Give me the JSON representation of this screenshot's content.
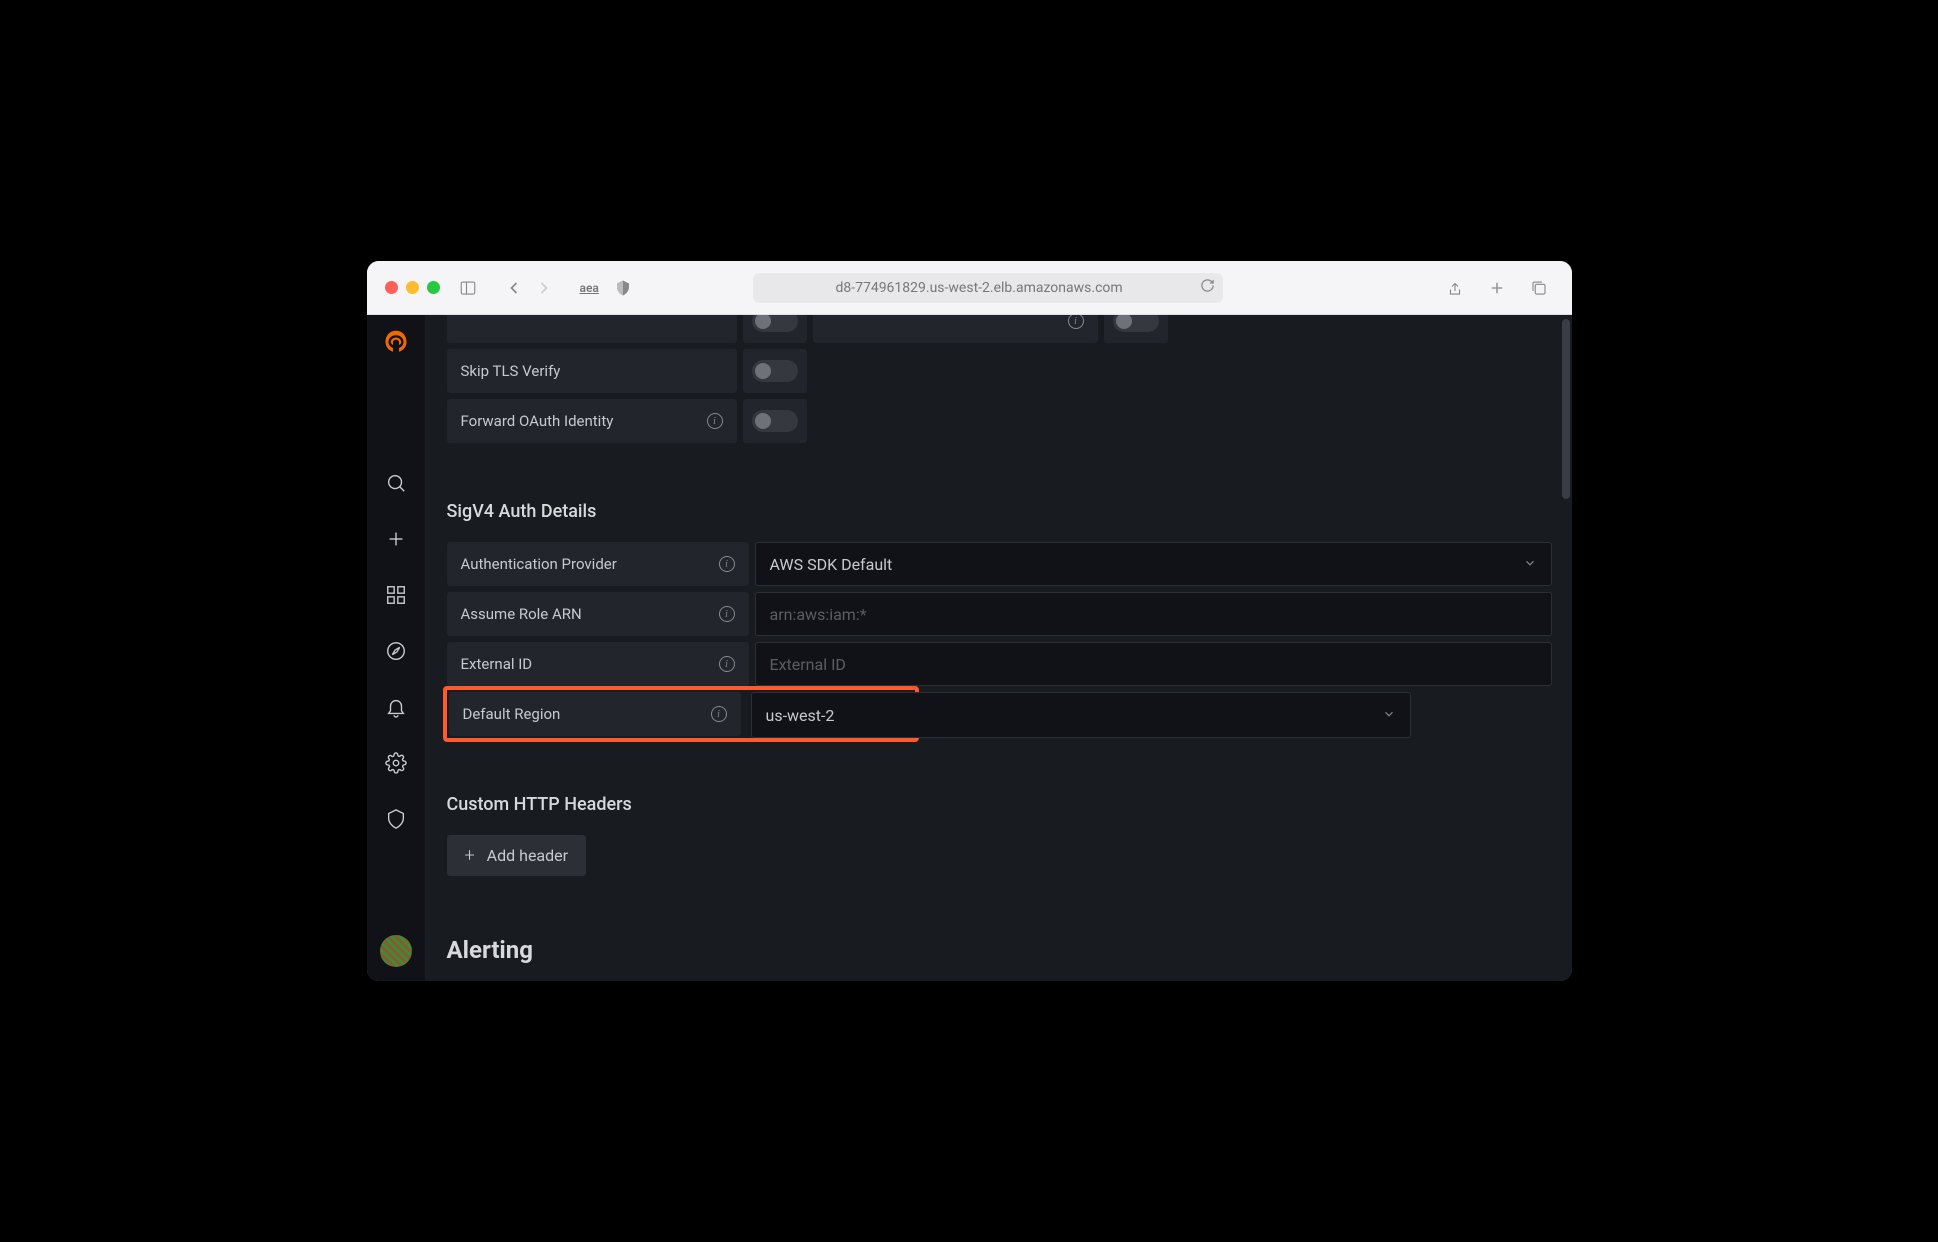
{
  "browser": {
    "url": "d8-774961829.us-west-2.elb.amazonaws.com",
    "ext_label": "aea"
  },
  "auth": {
    "skip_tls_label": "Skip TLS Verify",
    "forward_oauth_label": "Forward OAuth Identity"
  },
  "sigv4": {
    "heading": "SigV4 Auth Details",
    "auth_provider_label": "Authentication Provider",
    "auth_provider_value": "AWS SDK Default",
    "assume_role_label": "Assume Role ARN",
    "assume_role_placeholder": "arn:aws:iam:*",
    "external_id_label": "External ID",
    "external_id_placeholder": "External ID",
    "default_region_label": "Default Region",
    "default_region_value": "us-west-2"
  },
  "custom_headers": {
    "heading": "Custom HTTP Headers",
    "add_button": "Add header"
  },
  "alerting": {
    "heading": "Alerting"
  }
}
